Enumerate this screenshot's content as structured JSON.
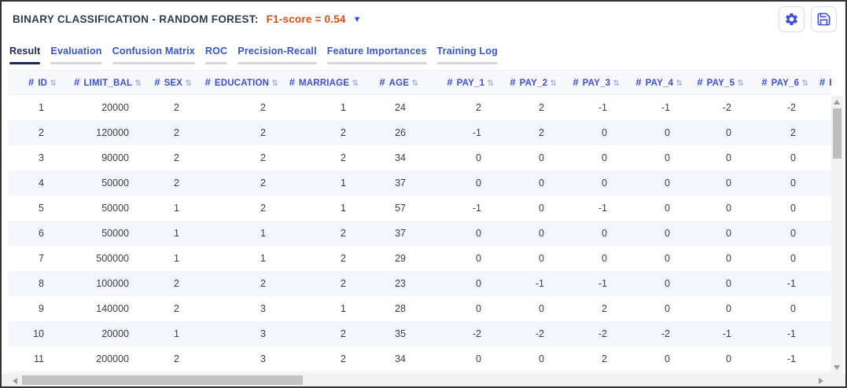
{
  "header": {
    "title": "BINARY CLASSIFICATION - RANDOM FOREST:",
    "score": "F1-score = 0.54",
    "caret_glyph": "▼"
  },
  "toolbar": {
    "settings_icon": "gear-icon",
    "save_icon": "save-icon"
  },
  "tabs": [
    {
      "label": "Result",
      "active": true
    },
    {
      "label": "Evaluation",
      "active": false
    },
    {
      "label": "Confusion Matrix",
      "active": false
    },
    {
      "label": "ROC",
      "active": false
    },
    {
      "label": "Precision-Recall",
      "active": false
    },
    {
      "label": "Feature Importances",
      "active": false
    },
    {
      "label": "Training Log",
      "active": false
    }
  ],
  "table": {
    "numeric_prefix": "#",
    "sort_glyph": "⇅",
    "columns": [
      "ID",
      "LIMIT_BAL",
      "SEX",
      "EDUCATION",
      "MARRIAGE",
      "AGE",
      "PAY_1",
      "PAY_2",
      "PAY_3",
      "PAY_4",
      "PAY_5",
      "PAY_6",
      "BI"
    ],
    "rows": [
      [
        1,
        20000,
        2,
        2,
        1,
        24,
        2,
        2,
        -1,
        -1,
        -2,
        -2
      ],
      [
        2,
        120000,
        2,
        2,
        2,
        26,
        -1,
        2,
        0,
        0,
        0,
        2
      ],
      [
        3,
        90000,
        2,
        2,
        2,
        34,
        0,
        0,
        0,
        0,
        0,
        0
      ],
      [
        4,
        50000,
        2,
        2,
        1,
        37,
        0,
        0,
        0,
        0,
        0,
        0
      ],
      [
        5,
        50000,
        1,
        2,
        1,
        57,
        -1,
        0,
        -1,
        0,
        0,
        0
      ],
      [
        6,
        50000,
        1,
        1,
        2,
        37,
        0,
        0,
        0,
        0,
        0,
        0
      ],
      [
        7,
        500000,
        1,
        1,
        2,
        29,
        0,
        0,
        0,
        0,
        0,
        0
      ],
      [
        8,
        100000,
        2,
        2,
        2,
        23,
        0,
        -1,
        -1,
        0,
        0,
        -1
      ],
      [
        9,
        140000,
        2,
        3,
        1,
        28,
        0,
        0,
        2,
        0,
        0,
        0
      ],
      [
        10,
        20000,
        1,
        3,
        2,
        35,
        -2,
        -2,
        -2,
        -2,
        -1,
        -1
      ],
      [
        11,
        200000,
        2,
        3,
        2,
        34,
        0,
        0,
        2,
        0,
        0,
        -1
      ]
    ]
  },
  "colors": {
    "accent_icon_blue": "#3d4fd6",
    "tab_blue": "#3355c8",
    "active_tab_navy": "#20285e",
    "score_orange": "#dd4e12",
    "column_header_blue": "#3c4fd0",
    "alt_row": "#f4f6fb",
    "title_navy": "#333b52"
  }
}
